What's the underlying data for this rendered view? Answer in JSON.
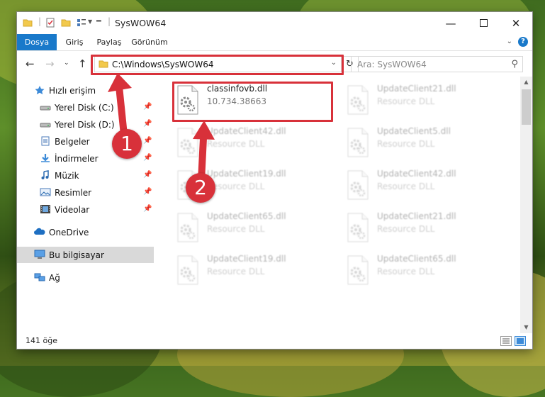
{
  "window": {
    "title": "SysWOW64"
  },
  "ribbon": {
    "tabs": [
      "Dosya",
      "Giriş",
      "Paylaş",
      "Görünüm"
    ],
    "help": "?"
  },
  "nav": {
    "address": "C:\\Windows\\SysWOW64",
    "search_placeholder": "Ara: SysWOW64"
  },
  "sidebar": {
    "items": [
      {
        "label": "Hızlı erişim",
        "icon": "star-icon",
        "pinned": false,
        "level": 0
      },
      {
        "label": "Yerel Disk (C:)",
        "icon": "drive-icon",
        "pinned": true,
        "level": 1
      },
      {
        "label": "Yerel Disk (D:)",
        "icon": "drive-icon",
        "pinned": true,
        "level": 1
      },
      {
        "label": "Belgeler",
        "icon": "documents-icon",
        "pinned": true,
        "level": 1
      },
      {
        "label": "İndirmeler",
        "icon": "download-icon",
        "pinned": true,
        "level": 1
      },
      {
        "label": "Müzik",
        "icon": "music-icon",
        "pinned": true,
        "level": 1
      },
      {
        "label": "Resimler",
        "icon": "pictures-icon",
        "pinned": true,
        "level": 1
      },
      {
        "label": "Videolar",
        "icon": "videos-icon",
        "pinned": true,
        "level": 1
      },
      {
        "label": "OneDrive",
        "icon": "cloud-icon",
        "pinned": false,
        "level": 0
      },
      {
        "label": "Bu bilgisayar",
        "icon": "computer-icon",
        "pinned": false,
        "level": 0,
        "selected": true
      },
      {
        "label": "Ağ",
        "icon": "network-icon",
        "pinned": false,
        "level": 0
      }
    ]
  },
  "files": [
    {
      "name": "classinfovb.dll",
      "desc": "10.734.38663",
      "faded": false
    },
    {
      "name": "UpdateClient21.dll",
      "desc": "Resource DLL",
      "faded": true
    },
    {
      "name": "UpdateClient42.dll",
      "desc": "Resource DLL",
      "faded": true
    },
    {
      "name": "UpdateClient5.dll",
      "desc": "Resource DLL",
      "faded": true
    },
    {
      "name": "UpdateClient19.dll",
      "desc": "Resource DLL",
      "faded": true
    },
    {
      "name": "UpdateClient42.dll",
      "desc": "Resource DLL",
      "faded": true
    },
    {
      "name": "UpdateClient65.dll",
      "desc": "Resource DLL",
      "faded": true
    },
    {
      "name": "UpdateClient21.dll",
      "desc": "Resource DLL",
      "faded": true
    },
    {
      "name": "UpdateClient19.dll",
      "desc": "Resource DLL",
      "faded": true
    },
    {
      "name": "UpdateClient65.dll",
      "desc": "Resource DLL",
      "faded": true
    }
  ],
  "status": {
    "count": "141 öğe"
  },
  "callouts": [
    "1",
    "2"
  ],
  "colors": {
    "accent": "#1979ca",
    "highlight": "#d8313a",
    "selected": "#d9d9d9"
  }
}
